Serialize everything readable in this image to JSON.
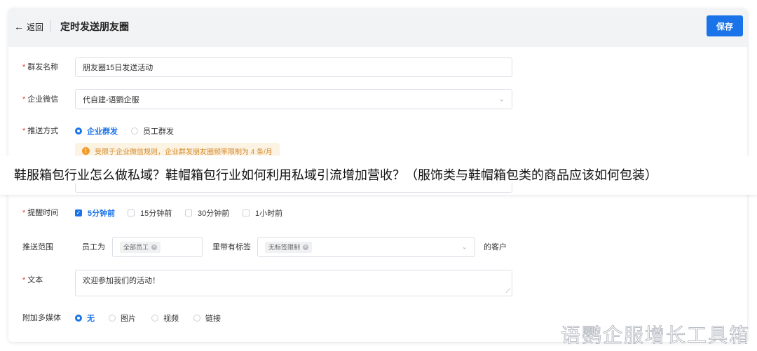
{
  "header": {
    "back_icon": "arrow-left-icon",
    "back_label": "返回",
    "title": "定时发送朋友圈",
    "save_label": "保存"
  },
  "form": {
    "required_mark": "*",
    "group_name": {
      "label": "群发名称",
      "value": "朋友圈15日发送活动"
    },
    "wecom": {
      "label": "企业微信",
      "value": "代自建-语鹦企服"
    },
    "push_method": {
      "label": "推送方式",
      "options": [
        "企业群发",
        "员工群发"
      ],
      "selected": "企业群发",
      "warning_icon": "warning-icon",
      "warning": "受限于企业微信规则，企业群发朋友圈频率限制为 4 条/月"
    },
    "reminder": {
      "label": "提醒时间",
      "options": [
        "5分钟前",
        "15分钟前",
        "30分钟前",
        "1小时前"
      ],
      "checked": "5分钟前"
    },
    "scope": {
      "label": "推送范围",
      "employee_label": "员工为",
      "employee_tag": "全部员工",
      "tag_label": "里带有标签",
      "tag_value": "无标签限制",
      "suffix": "的客户"
    },
    "text": {
      "label": "文本",
      "value": "欢迎参加我们的活动！"
    },
    "media": {
      "label": "附加多媒体",
      "options": [
        "无",
        "图片",
        "视频",
        "链接"
      ],
      "selected": "无"
    }
  },
  "banner": {
    "text": "鞋服箱包行业怎么做私域？鞋帽箱包行业如何利用私域引流增加营收？（服饰类与鞋帽箱包类的商品应该如何包装）"
  },
  "watermark": {
    "text": "语鹦企服增长工具箱"
  },
  "colors": {
    "accent": "#1a73e8",
    "required": "#e53935",
    "warning": "#f09b2b"
  }
}
